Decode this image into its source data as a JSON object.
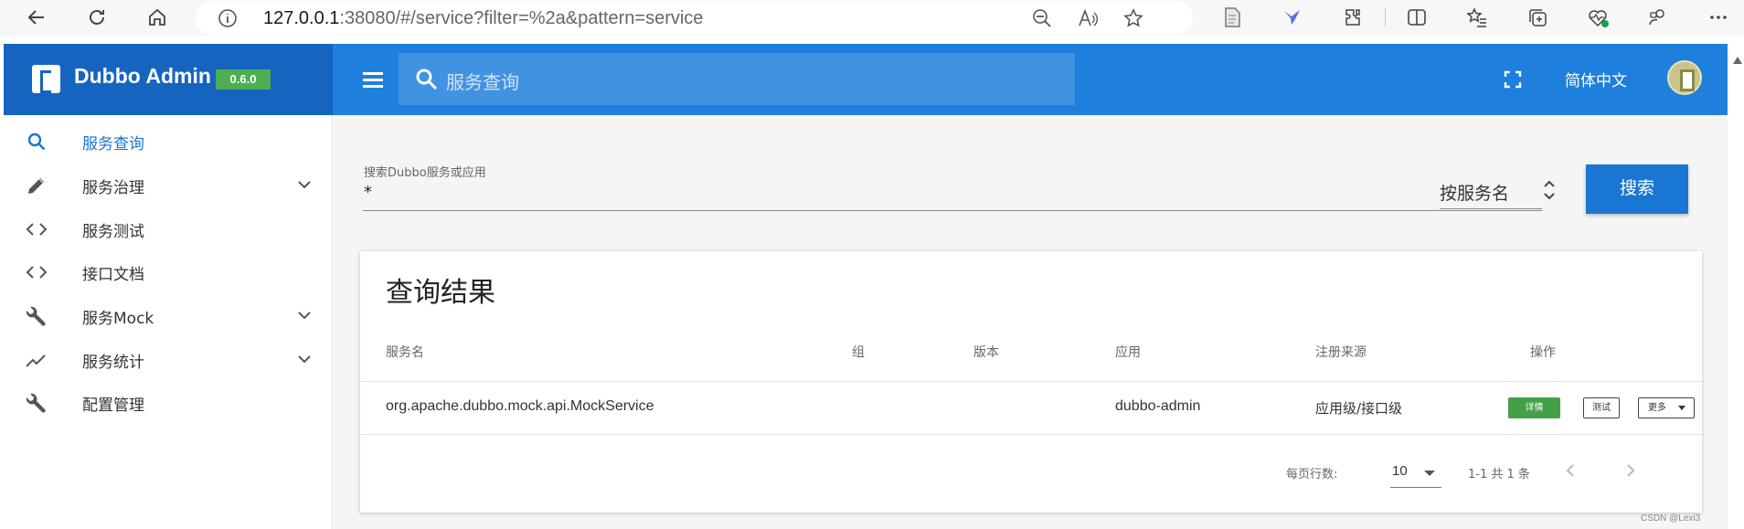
{
  "browser": {
    "url_host": "127.0.0.1",
    "url_rest": ":38080/#/service?filter=%2a&pattern=service"
  },
  "header": {
    "title": "Dubbo Admin",
    "version": "0.6.0",
    "search_placeholder": "服务查询",
    "language": "简体中文"
  },
  "sidebar": {
    "items": [
      {
        "label": "服务查询",
        "icon": "search-icon",
        "active": true,
        "expandable": false
      },
      {
        "label": "服务治理",
        "icon": "pencil-icon",
        "active": false,
        "expandable": true
      },
      {
        "label": "服务测试",
        "icon": "code-icon",
        "active": false,
        "expandable": false
      },
      {
        "label": "接口文档",
        "icon": "code-icon",
        "active": false,
        "expandable": false
      },
      {
        "label": "服务Mock",
        "icon": "wrench-icon",
        "active": false,
        "expandable": true
      },
      {
        "label": "服务统计",
        "icon": "trending-icon",
        "active": false,
        "expandable": true
      },
      {
        "label": "配置管理",
        "icon": "wrench-icon",
        "active": false,
        "expandable": false
      }
    ]
  },
  "filter": {
    "label": "搜索Dubbo服务或应用",
    "value": "*",
    "pattern_selected": "按服务名",
    "search_button": "搜索"
  },
  "results": {
    "title": "查询结果",
    "columns": [
      "服务名",
      "组",
      "版本",
      "应用",
      "注册来源",
      "操作"
    ],
    "rows": [
      {
        "service": "org.apache.dubbo.mock.api.MockService",
        "group": "",
        "version": "",
        "application": "dubbo-admin",
        "source": "应用级/接口级"
      }
    ],
    "actions": {
      "detail": "详情",
      "test": "测试",
      "more": "更多"
    },
    "rows_per_page_label": "每页行数:",
    "rows_per_page": "10",
    "range": "1-1 共 1 条"
  },
  "watermark": "CSDN @Lexi3",
  "colors": {
    "primary": "#1976d2",
    "header": "#1f7fdc",
    "brand": "#1565c0",
    "success": "#4caf50"
  }
}
